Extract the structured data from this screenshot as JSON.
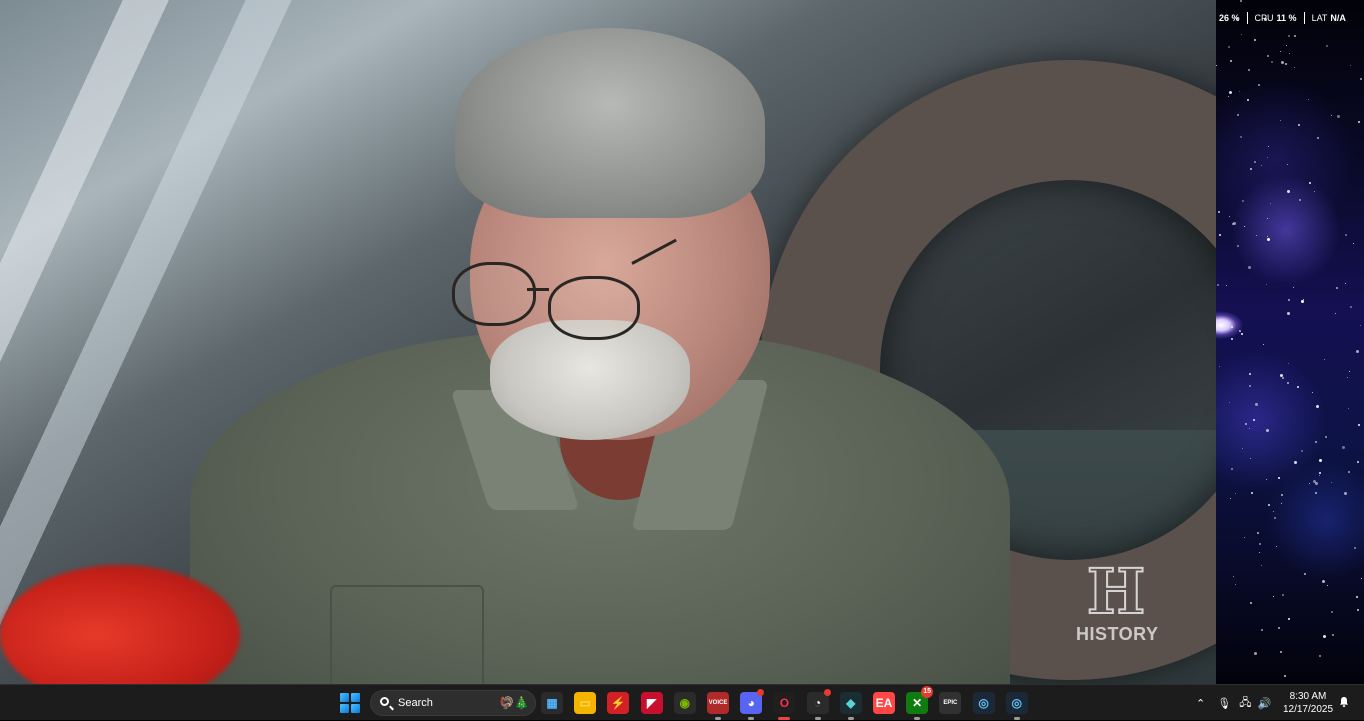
{
  "video": {
    "watermark_text": "HISTORY",
    "watermark_logo": "H"
  },
  "side_panel": {
    "gpu_value": "26 %",
    "cpu_label": "CPU",
    "cpu_value": "11 %",
    "lat_label": "LAT",
    "lat_value": "N/A"
  },
  "taskbar": {
    "search_placeholder": "Search",
    "search_decoration": "🦃🎄",
    "icons": [
      {
        "name": "microsoft-store-icon",
        "glyph": "▦",
        "bg": "#2b2b2b",
        "fg": "#4fb3ff"
      },
      {
        "name": "file-explorer-icon",
        "glyph": "▭",
        "bg": "#f4b400",
        "fg": "#ffd65c"
      },
      {
        "name": "app-red-bolt-icon",
        "glyph": "⚡",
        "bg": "#d31f26",
        "fg": "#ffffff"
      },
      {
        "name": "amd-software-icon",
        "glyph": "◤",
        "bg": "#c8102e",
        "fg": "#ffffff"
      },
      {
        "name": "nvidia-icon",
        "glyph": "◉",
        "bg": "#2b2b2b",
        "fg": "#76b900"
      },
      {
        "name": "voicemeeter-icon",
        "glyph": "VOICE",
        "bg": "#b02a2a",
        "fg": "#ffffff"
      },
      {
        "name": "discord-icon",
        "glyph": "◕",
        "bg": "#5865f2",
        "fg": "#ffffff"
      },
      {
        "name": "opera-gx-icon",
        "glyph": "O",
        "bg": "#1f1f1f",
        "fg": "#ff2a55"
      },
      {
        "name": "app-circle-icon",
        "glyph": "◔",
        "bg": "#2b2b2b",
        "fg": "#ffffff"
      },
      {
        "name": "app-dark-icon",
        "glyph": "◆",
        "bg": "#1a2d33",
        "fg": "#5fd0d0"
      },
      {
        "name": "ea-app-icon",
        "glyph": "EA",
        "bg": "#ff4747",
        "fg": "#ffffff"
      },
      {
        "name": "xbox-icon",
        "glyph": "✕",
        "bg": "#107c10",
        "fg": "#ffffff"
      },
      {
        "name": "epic-games-icon",
        "glyph": "EPIC",
        "bg": "#313131",
        "fg": "#ffffff"
      },
      {
        "name": "steam-icon",
        "glyph": "◎",
        "bg": "#1b2838",
        "fg": "#66c0f4"
      },
      {
        "name": "steam-icon-2",
        "glyph": "◎",
        "bg": "#1b2838",
        "fg": "#66c0f4"
      }
    ],
    "discord_badge": "",
    "app_circle_badge": "",
    "xbox_badge": "15",
    "tray": {
      "chevron": "⌃",
      "mic": "🎙",
      "network": "🖧",
      "volume": "🔊"
    },
    "clock_time": "8:30 AM",
    "clock_date": "12/17/2025"
  }
}
